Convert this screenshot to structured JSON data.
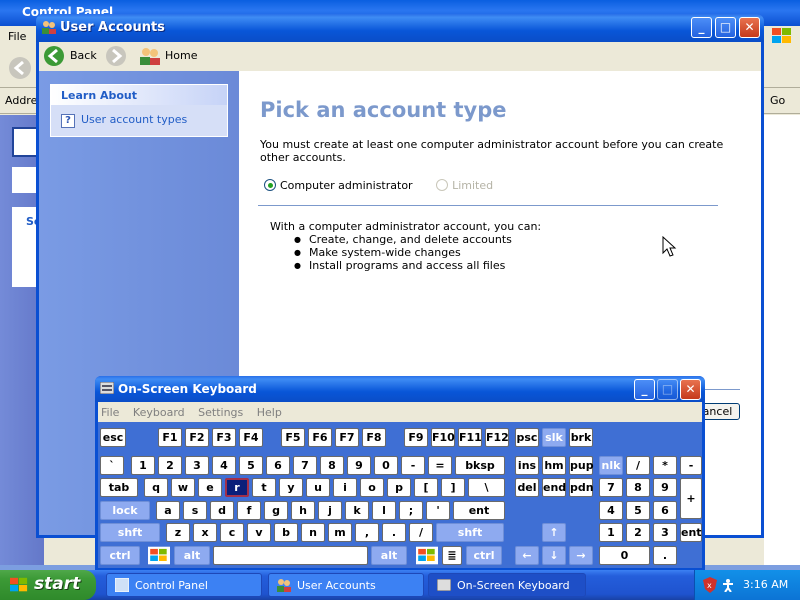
{
  "control_panel": {
    "title": "Control Panel",
    "menu_file": "File",
    "address_label": "Addre",
    "go_label": "Go",
    "left_letters": "Se"
  },
  "user_accounts": {
    "title": "User Accounts",
    "nav": {
      "back": "Back",
      "home": "Home"
    },
    "sidebar": {
      "panel_title": "Learn About",
      "item": "User account types"
    },
    "heading": "Pick an account type",
    "intro": "You must create at least one computer administrator account before you can create other accounts.",
    "options": {
      "admin": "Computer administrator",
      "limited": "Limited",
      "selected": "Computer administrator"
    },
    "desc_title": "With a computer administrator account, you can:",
    "desc_items": [
      "Create, change, and delete accounts",
      "Make system-wide changes",
      "Install programs and access all files"
    ],
    "cancel": "Cancel"
  },
  "osk": {
    "title": "On-Screen Keyboard",
    "menu": [
      "File",
      "Keyboard",
      "Settings",
      "Help"
    ],
    "selected_key": "r",
    "rows": {
      "row1": [
        "esc",
        "F1",
        "F2",
        "F3",
        "F4",
        "F5",
        "F6",
        "F7",
        "F8",
        "F9",
        "F10",
        "F11",
        "F12",
        "psc",
        "slk",
        "brk"
      ],
      "row2": [
        "`",
        "1",
        "2",
        "3",
        "4",
        "5",
        "6",
        "7",
        "8",
        "9",
        "0",
        "-",
        "=",
        "bksp",
        "ins",
        "hm",
        "pup",
        "nlk",
        "/",
        "*",
        "-"
      ],
      "row3": [
        "tab",
        "q",
        "w",
        "e",
        "r",
        "t",
        "y",
        "u",
        "i",
        "o",
        "p",
        "[",
        "]",
        "\\",
        "del",
        "end",
        "pdn",
        "7",
        "8",
        "9",
        "+"
      ],
      "row4": [
        "lock",
        "a",
        "s",
        "d",
        "f",
        "g",
        "h",
        "j",
        "k",
        "l",
        ";",
        "'",
        "ent",
        "4",
        "5",
        "6"
      ],
      "row5": [
        "shft",
        "z",
        "x",
        "c",
        "v",
        "b",
        "n",
        "m",
        ",",
        ".",
        "/",
        "shft",
        "↑",
        "1",
        "2",
        "3",
        "ent"
      ],
      "row6": [
        "ctrl",
        "alt",
        "",
        "alt",
        "ctrl",
        "←",
        "↓",
        "→",
        "0",
        "."
      ]
    }
  },
  "taskbar": {
    "start": "start",
    "items": [
      "Control Panel",
      "User Accounts",
      "On-Screen Keyboard"
    ],
    "clock": "3:16 AM"
  },
  "colors": {
    "xp_blue": "#0a4fd2",
    "heading": "#7c99cc",
    "start_green": "#3c9a36"
  }
}
